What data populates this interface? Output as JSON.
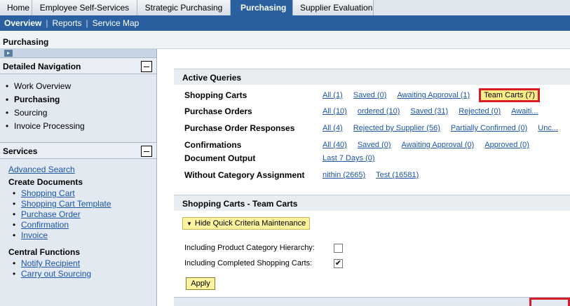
{
  "tabs": {
    "home": "Home",
    "ess": "Employee Self-Services",
    "strategic": "Strategic Purchasing",
    "purchasing": "Purchasing",
    "supplier": "Supplier Evaluation"
  },
  "subnav": {
    "overview": "Overview",
    "reports": "Reports",
    "service_map": "Service Map",
    "sep": "|"
  },
  "page_title": "Purchasing",
  "sidebar": {
    "detailed_nav_title": "Detailed Navigation",
    "nav_items": [
      "Work Overview",
      "Purchasing",
      "Sourcing",
      "Invoice Processing"
    ],
    "services_title": "Services",
    "advanced_search": "Advanced Search",
    "create_docs_title": "Create Documents",
    "create_docs": [
      "Shopping Cart",
      "Shopping Cart Template",
      "Purchase Order",
      "Confirmation",
      "Invoice"
    ],
    "central_title": "Central Functions",
    "central": [
      "Notify Recipient",
      "Carry out Sourcing"
    ]
  },
  "active_queries": {
    "title": "Active Queries",
    "rows": [
      {
        "label": "Shopping Carts",
        "links": [
          "All (1)",
          "Saved (0)",
          "Awaiting Approval (1)",
          "Team Carts (7)"
        ]
      },
      {
        "label": "Purchase Orders",
        "links": [
          "All (10)",
          "ordered (10)",
          "Saved (31)",
          "Rejected (0)",
          "Awaiti..."
        ]
      },
      {
        "label": "Purchase Order Responses",
        "links": [
          "All (4)",
          "Rejected by Supplier (56)",
          "Partially Confirmed (0)",
          "Unc..."
        ]
      },
      {
        "label": "Confirmations",
        "links": [
          "All (40)",
          "Saved (0)",
          "Awaiting Approval (0)",
          "Approved (0)"
        ]
      },
      {
        "label": "Document Output",
        "links": [
          "Last 7 Days (0)"
        ]
      },
      {
        "label": "Without Category Assignment",
        "links": [
          "nithin (2665)",
          "Test (16581)"
        ]
      }
    ]
  },
  "shopping_carts": {
    "title": "Shopping Carts - Team Carts",
    "hide_qcm": "Hide Quick Criteria Maintenance",
    "crit_product": "Including Product Category Hierarchy:",
    "crit_completed": "Including Completed Shopping Carts:",
    "product_checked": false,
    "completed_checked": true,
    "check_mark": "✔",
    "apply": "Apply"
  },
  "colors": {
    "nav_blue": "#2a5fa0",
    "link": "#1b55a6",
    "highlight": "#ffee88",
    "callout_red": "#d71e28"
  }
}
